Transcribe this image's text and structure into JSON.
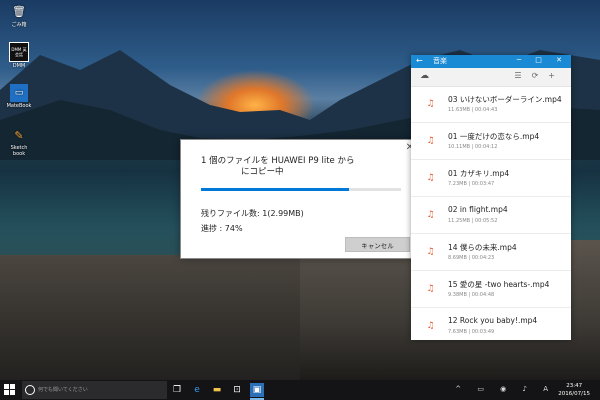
{
  "desktop": {
    "icons": [
      {
        "label": "ごみ箱",
        "icon": "recycle-bin-icon"
      },
      {
        "label": "DMM",
        "icon": "dmm-app-icon",
        "badge": "DMM 英会話"
      },
      {
        "label": "MateBook",
        "icon": "matebook-icon"
      },
      {
        "label": "Sketch book",
        "icon": "sketchbook-icon"
      }
    ]
  },
  "copy_dialog": {
    "title_line1": "1 個のファイルを HUAWEI P9 lite から",
    "title_line2": "にコピー中",
    "progress": 0.74,
    "remaining_text": "残りファイル数: 1(2.99MB)",
    "progress_text": "進捗 : 74%",
    "cancel_label": "キャンセル",
    "close_glyph": "✕"
  },
  "phone_window": {
    "title": "音楽",
    "back_glyph": "←",
    "window_controls": "─ □ ✕",
    "files": [
      {
        "name": "03 いけないボーダーライン.mp4",
        "meta": "11.63MB | 00:04:43"
      },
      {
        "name": "01 一度だけの恋なら.mp4",
        "meta": "10.11MB | 00:04:12"
      },
      {
        "name": "01 カザキリ.mp4",
        "meta": "7.23MB | 00:03:47"
      },
      {
        "name": "02 in flight.mp4",
        "meta": "11.25MB | 00:05:52"
      },
      {
        "name": "14 僕らの未来.mp4",
        "meta": "8.69MB | 00:04:23"
      },
      {
        "name": "15 愛の星 -two hearts-.mp4",
        "meta": "9.38MB | 00:04:48"
      },
      {
        "name": "12 Rock you baby!.mp4",
        "meta": "7.63MB | 00:03:49"
      }
    ]
  },
  "taskbar": {
    "search_placeholder": "何でも聞いてください",
    "time": "23:47",
    "date": "2016/07/15",
    "accent": "#0078d7"
  }
}
